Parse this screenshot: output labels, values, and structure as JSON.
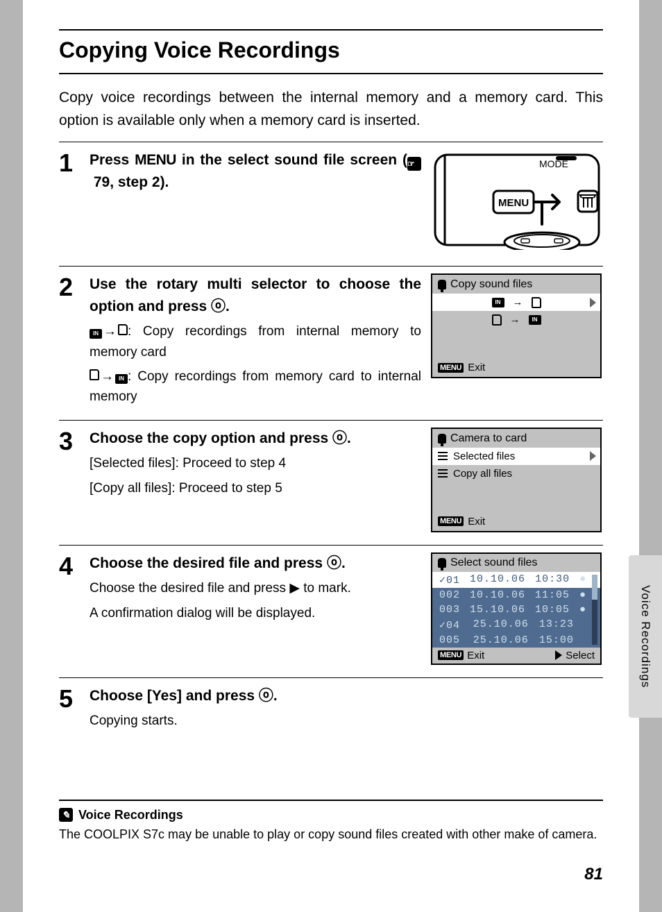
{
  "title": "Copying Voice Recordings",
  "intro": "Copy voice recordings between the internal memory and a memory card. This option is available only when a memory card is inserted.",
  "steps": {
    "s1": {
      "num": "1",
      "head_a": "Press ",
      "menu": "MENU",
      "head_b": " in the select sound file screen (",
      "ref": "79, step 2).",
      "cam_mode": "MODE",
      "cam_menu": "MENU"
    },
    "s2": {
      "num": "2",
      "head": "Use the rotary multi selector to choose the option and press ",
      "ok": "d",
      "head_end": ".",
      "sub1": ": Copy recordings from internal memory to memory card",
      "sub2": ": Copy recordings from memory card to internal memory",
      "lcd_title": "Copy sound files",
      "lcd_exit": "Exit"
    },
    "s3": {
      "num": "3",
      "head": "Choose the copy option and press ",
      "head_end": ".",
      "sub1": "[Selected files]: Proceed to step 4",
      "sub2": "[Copy all files]: Proceed to step 5",
      "lcd_title": "Camera to card",
      "opt1": "Selected files",
      "opt2": "Copy all files",
      "lcd_exit": "Exit"
    },
    "s4": {
      "num": "4",
      "head": "Choose the desired file and press ",
      "head_end": ".",
      "sub1": "Choose the desired file and press ▶ to mark.",
      "sub2": "A confirmation dialog will be displayed.",
      "lcd_title": "Select sound files",
      "rows": [
        {
          "id": "01",
          "date": "10.10.06",
          "time": "10:30",
          "mic": true,
          "sel": true,
          "chk": true
        },
        {
          "id": "002",
          "date": "10.10.06",
          "time": "11:05",
          "mic": true
        },
        {
          "id": "003",
          "date": "15.10.06",
          "time": "10:05",
          "mic": true
        },
        {
          "id": "04",
          "date": "25.10.06",
          "time": "13:23",
          "chk": true
        },
        {
          "id": "005",
          "date": "25.10.06",
          "time": "15:00"
        }
      ],
      "lcd_exit": "Exit",
      "lcd_select": "Select"
    },
    "s5": {
      "num": "5",
      "head": "Choose [Yes] and press ",
      "head_end": ".",
      "sub1": "Copying starts."
    }
  },
  "note": {
    "title": "Voice Recordings",
    "body": "The COOLPIX S7c may be unable to play or copy sound files created with other make of camera."
  },
  "sidetab": "Voice Recordings",
  "pagenum": "81",
  "glyph": {
    "arrow_right": "→",
    "check": "✓"
  }
}
